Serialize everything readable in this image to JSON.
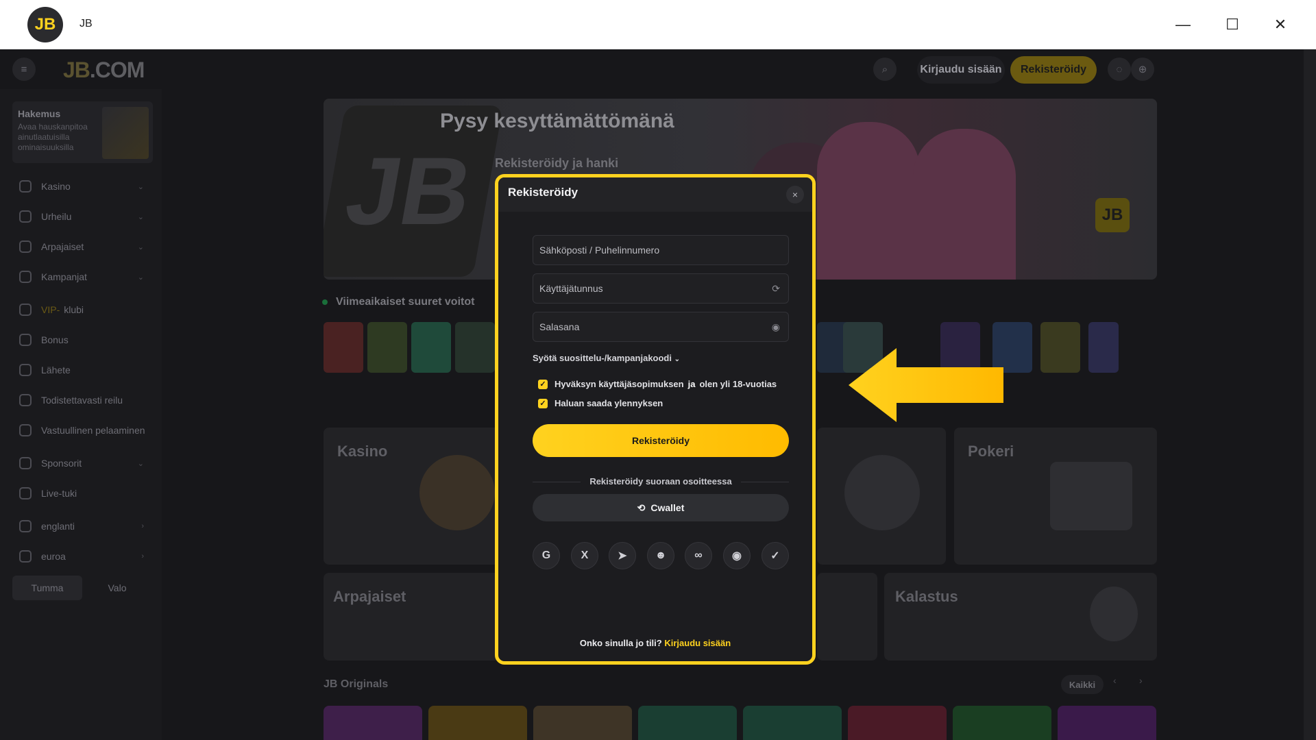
{
  "window": {
    "title": "JB",
    "logo_text": "JB",
    "minimize": "—",
    "maximize": "☐",
    "close": "✕"
  },
  "header": {
    "brand_a": "JB",
    "brand_b": ".COM",
    "login": "Kirjaudu sisään",
    "register": "Rekisteröidy"
  },
  "sidebar": {
    "promo_title": "Hakemus",
    "promo_desc": "Avaa hauskanpitoa ainutlaatuisilla ominaisuuksilla",
    "items": [
      {
        "label": "Kasino",
        "chevron": "⌄"
      },
      {
        "label": "Urheilu",
        "chevron": "⌄"
      },
      {
        "label": "Arpajaiset",
        "chevron": "⌄"
      },
      {
        "label": "Kampanjat",
        "chevron": "⌄"
      },
      {
        "label": "klubi",
        "prefix": "VIP-"
      },
      {
        "label": "Bonus"
      },
      {
        "label": "Lähete"
      },
      {
        "label": "Todistettavasti reilu"
      },
      {
        "label": "Vastuullinen pelaaminen"
      },
      {
        "label": "Sponsorit",
        "chevron": "⌄"
      },
      {
        "label": "Live-tuki"
      },
      {
        "label": "englanti",
        "chevron": "›"
      },
      {
        "label": "euroa",
        "chevron": "›"
      }
    ],
    "theme_dark": "Tumma",
    "theme_light": "Valo"
  },
  "main": {
    "banner_title": "Pysy kesyttämättömänä",
    "banner_sub": "Rekisteröidy ja hanki",
    "banner_badge": "JB",
    "wins_title": "Viimeaikaiset suuret voitot",
    "categories": [
      "Kasino",
      "Pokeri",
      "Arpajaiset",
      "Kalastus"
    ],
    "originals_title": "JB Originals",
    "all_button": "Kaikki"
  },
  "modal": {
    "title": "Rekisteröidy",
    "close": "×",
    "email_placeholder": "Sähköposti / Puhelinnumero",
    "username_placeholder": "Käyttäjätunnus",
    "password_placeholder": "Salasana",
    "referral": "Syötä suosittelu-/kampanjakoodi",
    "terms_a": "Hyväksyn käyttäjäsopimuksen",
    "terms_and": "ja",
    "terms_b": "olen yli 18-vuotias",
    "promo_opt": "Haluan saada ylennyksen",
    "submit": "Rekisteröidy",
    "direct": "Rekisteröidy suoraan osoitteessa",
    "cwallet": "Cwallet",
    "social": [
      "G",
      "X",
      "➤",
      "☻",
      "∞",
      "◉",
      "✓"
    ],
    "have_account": "Onko sinulla jo tili?",
    "login_link": "Kirjaudu sisään"
  },
  "colors": {
    "accent": "#ffd21f",
    "arrow": "#ffd21f"
  }
}
